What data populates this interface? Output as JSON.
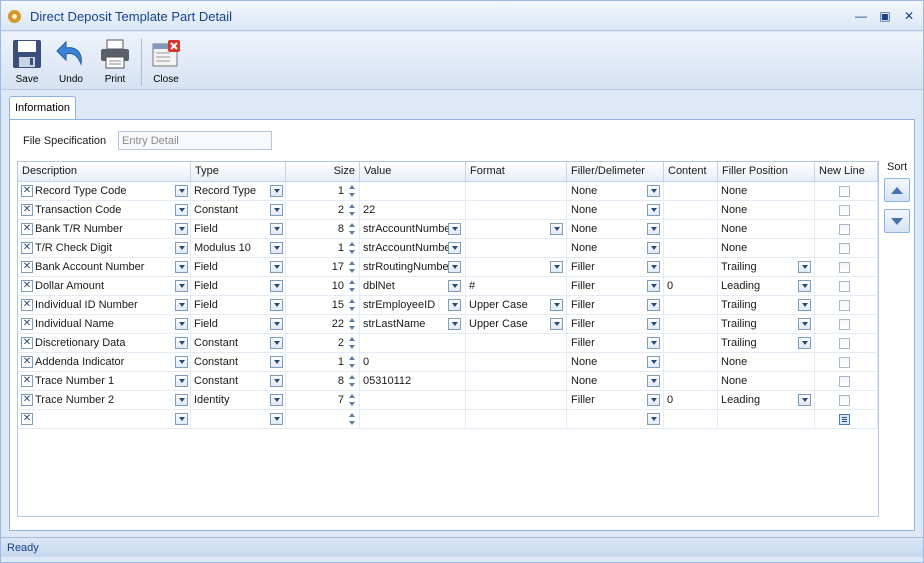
{
  "window": {
    "title": "Direct Deposit Template Part Detail"
  },
  "toolbar": {
    "save_label": "Save",
    "undo_label": "Undo",
    "print_label": "Print",
    "close_label": "Close"
  },
  "tabs": [
    {
      "label": "Information"
    }
  ],
  "file_spec": {
    "label": "File Specification",
    "value": "Entry Detail"
  },
  "grid": {
    "columns": [
      "Description",
      "Type",
      "Size",
      "Value",
      "Format",
      "Filler/Delimeter",
      "Content",
      "Filler Position",
      "New Line"
    ],
    "rows": [
      {
        "description": "Record Type Code",
        "type": "Record Type",
        "size": "1",
        "value": "",
        "format": "",
        "filler": "None",
        "content": "",
        "position": "None",
        "value_dd": false,
        "format_dd": false,
        "filler_dd": true,
        "position_dd": false
      },
      {
        "description": "Transaction Code",
        "type": "Constant",
        "size": "2",
        "value": "22",
        "format": "",
        "filler": "None",
        "content": "",
        "position": "None",
        "value_dd": false,
        "format_dd": false,
        "filler_dd": true,
        "position_dd": false
      },
      {
        "description": "Bank T/R Number",
        "type": "Field",
        "size": "8",
        "value": "strAccountNumber",
        "format": "",
        "filler": "None",
        "content": "",
        "position": "None",
        "value_dd": true,
        "format_dd": true,
        "filler_dd": true,
        "position_dd": false
      },
      {
        "description": "T/R Check Digit",
        "type": "Modulus 10",
        "size": "1",
        "value": "strAccountNumber",
        "format": "",
        "filler": "None",
        "content": "",
        "position": "None",
        "value_dd": true,
        "format_dd": false,
        "filler_dd": true,
        "position_dd": false
      },
      {
        "description": "Bank Account Number",
        "type": "Field",
        "size": "17",
        "value": "strRoutingNumber",
        "format": "",
        "filler": "Filler",
        "content": "",
        "position": "Trailing",
        "value_dd": true,
        "format_dd": true,
        "filler_dd": true,
        "position_dd": true
      },
      {
        "description": "Dollar Amount",
        "type": "Field",
        "size": "10",
        "value": "dblNet",
        "format": "#",
        "filler": "Filler",
        "content": "0",
        "position": "Leading",
        "value_dd": true,
        "format_dd": false,
        "filler_dd": true,
        "position_dd": true
      },
      {
        "description": "Individual ID Number",
        "type": "Field",
        "size": "15",
        "value": "strEmployeeID",
        "format": "Upper Case",
        "filler": "Filler",
        "content": "",
        "position": "Trailing",
        "value_dd": true,
        "format_dd": true,
        "filler_dd": true,
        "position_dd": true
      },
      {
        "description": "Individual Name",
        "type": "Field",
        "size": "22",
        "value": "strLastName",
        "format": "Upper Case",
        "filler": "Filler",
        "content": "",
        "position": "Trailing",
        "value_dd": true,
        "format_dd": true,
        "filler_dd": true,
        "position_dd": true
      },
      {
        "description": "Discretionary Data",
        "type": "Constant",
        "size": "2",
        "value": "",
        "format": "",
        "filler": "Filler",
        "content": "",
        "position": "Trailing",
        "value_dd": false,
        "format_dd": false,
        "filler_dd": true,
        "position_dd": true
      },
      {
        "description": "Addenda Indicator",
        "type": "Constant",
        "size": "1",
        "value": "0",
        "format": "",
        "filler": "None",
        "content": "",
        "position": "None",
        "value_dd": false,
        "format_dd": false,
        "filler_dd": true,
        "position_dd": false
      },
      {
        "description": "Trace Number 1",
        "type": "Constant",
        "size": "8",
        "value": "05310112",
        "format": "",
        "filler": "None",
        "content": "",
        "position": "None",
        "value_dd": false,
        "format_dd": false,
        "filler_dd": true,
        "position_dd": false
      },
      {
        "description": "Trace Number 2",
        "type": "Identity",
        "size": "7",
        "value": "",
        "format": "",
        "filler": "Filler",
        "content": "0",
        "position": "Leading",
        "value_dd": false,
        "format_dd": false,
        "filler_dd": true,
        "position_dd": true
      },
      {
        "description": "",
        "type": "",
        "size": "",
        "value": "",
        "format": "",
        "filler": "",
        "content": "",
        "position": "",
        "value_dd": false,
        "format_dd": false,
        "filler_dd": true,
        "position_dd": false,
        "new_row": true
      }
    ]
  },
  "sort": {
    "label": "Sort"
  },
  "status": {
    "text": "Ready"
  }
}
